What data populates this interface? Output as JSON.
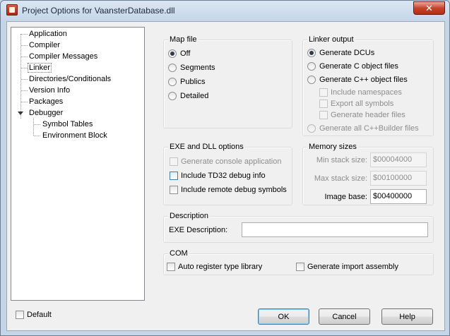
{
  "window": {
    "title": "Project Options for VaansterDatabase.dll",
    "close_glyph": "✕"
  },
  "tree": {
    "items": [
      {
        "label": "Application"
      },
      {
        "label": "Compiler"
      },
      {
        "label": "Compiler Messages"
      },
      {
        "label": "Linker",
        "selected": true
      },
      {
        "label": "Directories/Conditionals"
      },
      {
        "label": "Version Info"
      },
      {
        "label": "Packages"
      },
      {
        "label": "Debugger",
        "expanded": true
      },
      {
        "label": "Symbol Tables"
      },
      {
        "label": "Environment Block"
      }
    ]
  },
  "map_file": {
    "title": "Map file",
    "options": [
      {
        "label": "Off",
        "selected": true
      },
      {
        "label": "Segments",
        "selected": false
      },
      {
        "label": "Publics",
        "selected": false
      },
      {
        "label": "Detailed",
        "selected": false
      }
    ]
  },
  "linker_output": {
    "title": "Linker output",
    "options": [
      {
        "label": "Generate DCUs",
        "selected": true
      },
      {
        "label": "Generate C object files",
        "selected": false
      },
      {
        "label": "Generate C++ object files",
        "selected": false
      }
    ],
    "sub_checks": [
      {
        "label": "Include namespaces",
        "checked": false,
        "enabled": false
      },
      {
        "label": "Export all symbols",
        "checked": false,
        "enabled": false
      },
      {
        "label": "Generate header files",
        "checked": false,
        "enabled": false
      }
    ],
    "builder_option": {
      "label": "Generate all C++Builder files",
      "selected": false,
      "enabled": false
    }
  },
  "exe_dll": {
    "title": "EXE and DLL options",
    "checks": [
      {
        "label": "Generate console application",
        "checked": false,
        "enabled": false
      },
      {
        "label": "Include TD32 debug info",
        "checked": false,
        "enabled": true
      },
      {
        "label": "Include remote debug symbols",
        "checked": false,
        "enabled": true
      }
    ]
  },
  "memory": {
    "title": "Memory sizes",
    "min_stack": {
      "label": "Min stack size:",
      "value": "$00004000"
    },
    "max_stack": {
      "label": "Max stack size:",
      "value": "$00100000"
    },
    "image_base": {
      "label": "Image base:",
      "value": "$00400000"
    }
  },
  "description": {
    "title": "Description",
    "exe_label": "EXE Description:",
    "exe_value": ""
  },
  "com": {
    "title": "COM",
    "auto_register": {
      "label": "Auto register type library",
      "checked": false
    },
    "import_assembly": {
      "label": "Generate import assembly",
      "checked": false
    }
  },
  "footer": {
    "default_label": "Default",
    "default_checked": false,
    "ok": "OK",
    "cancel": "Cancel",
    "help": "Help"
  }
}
